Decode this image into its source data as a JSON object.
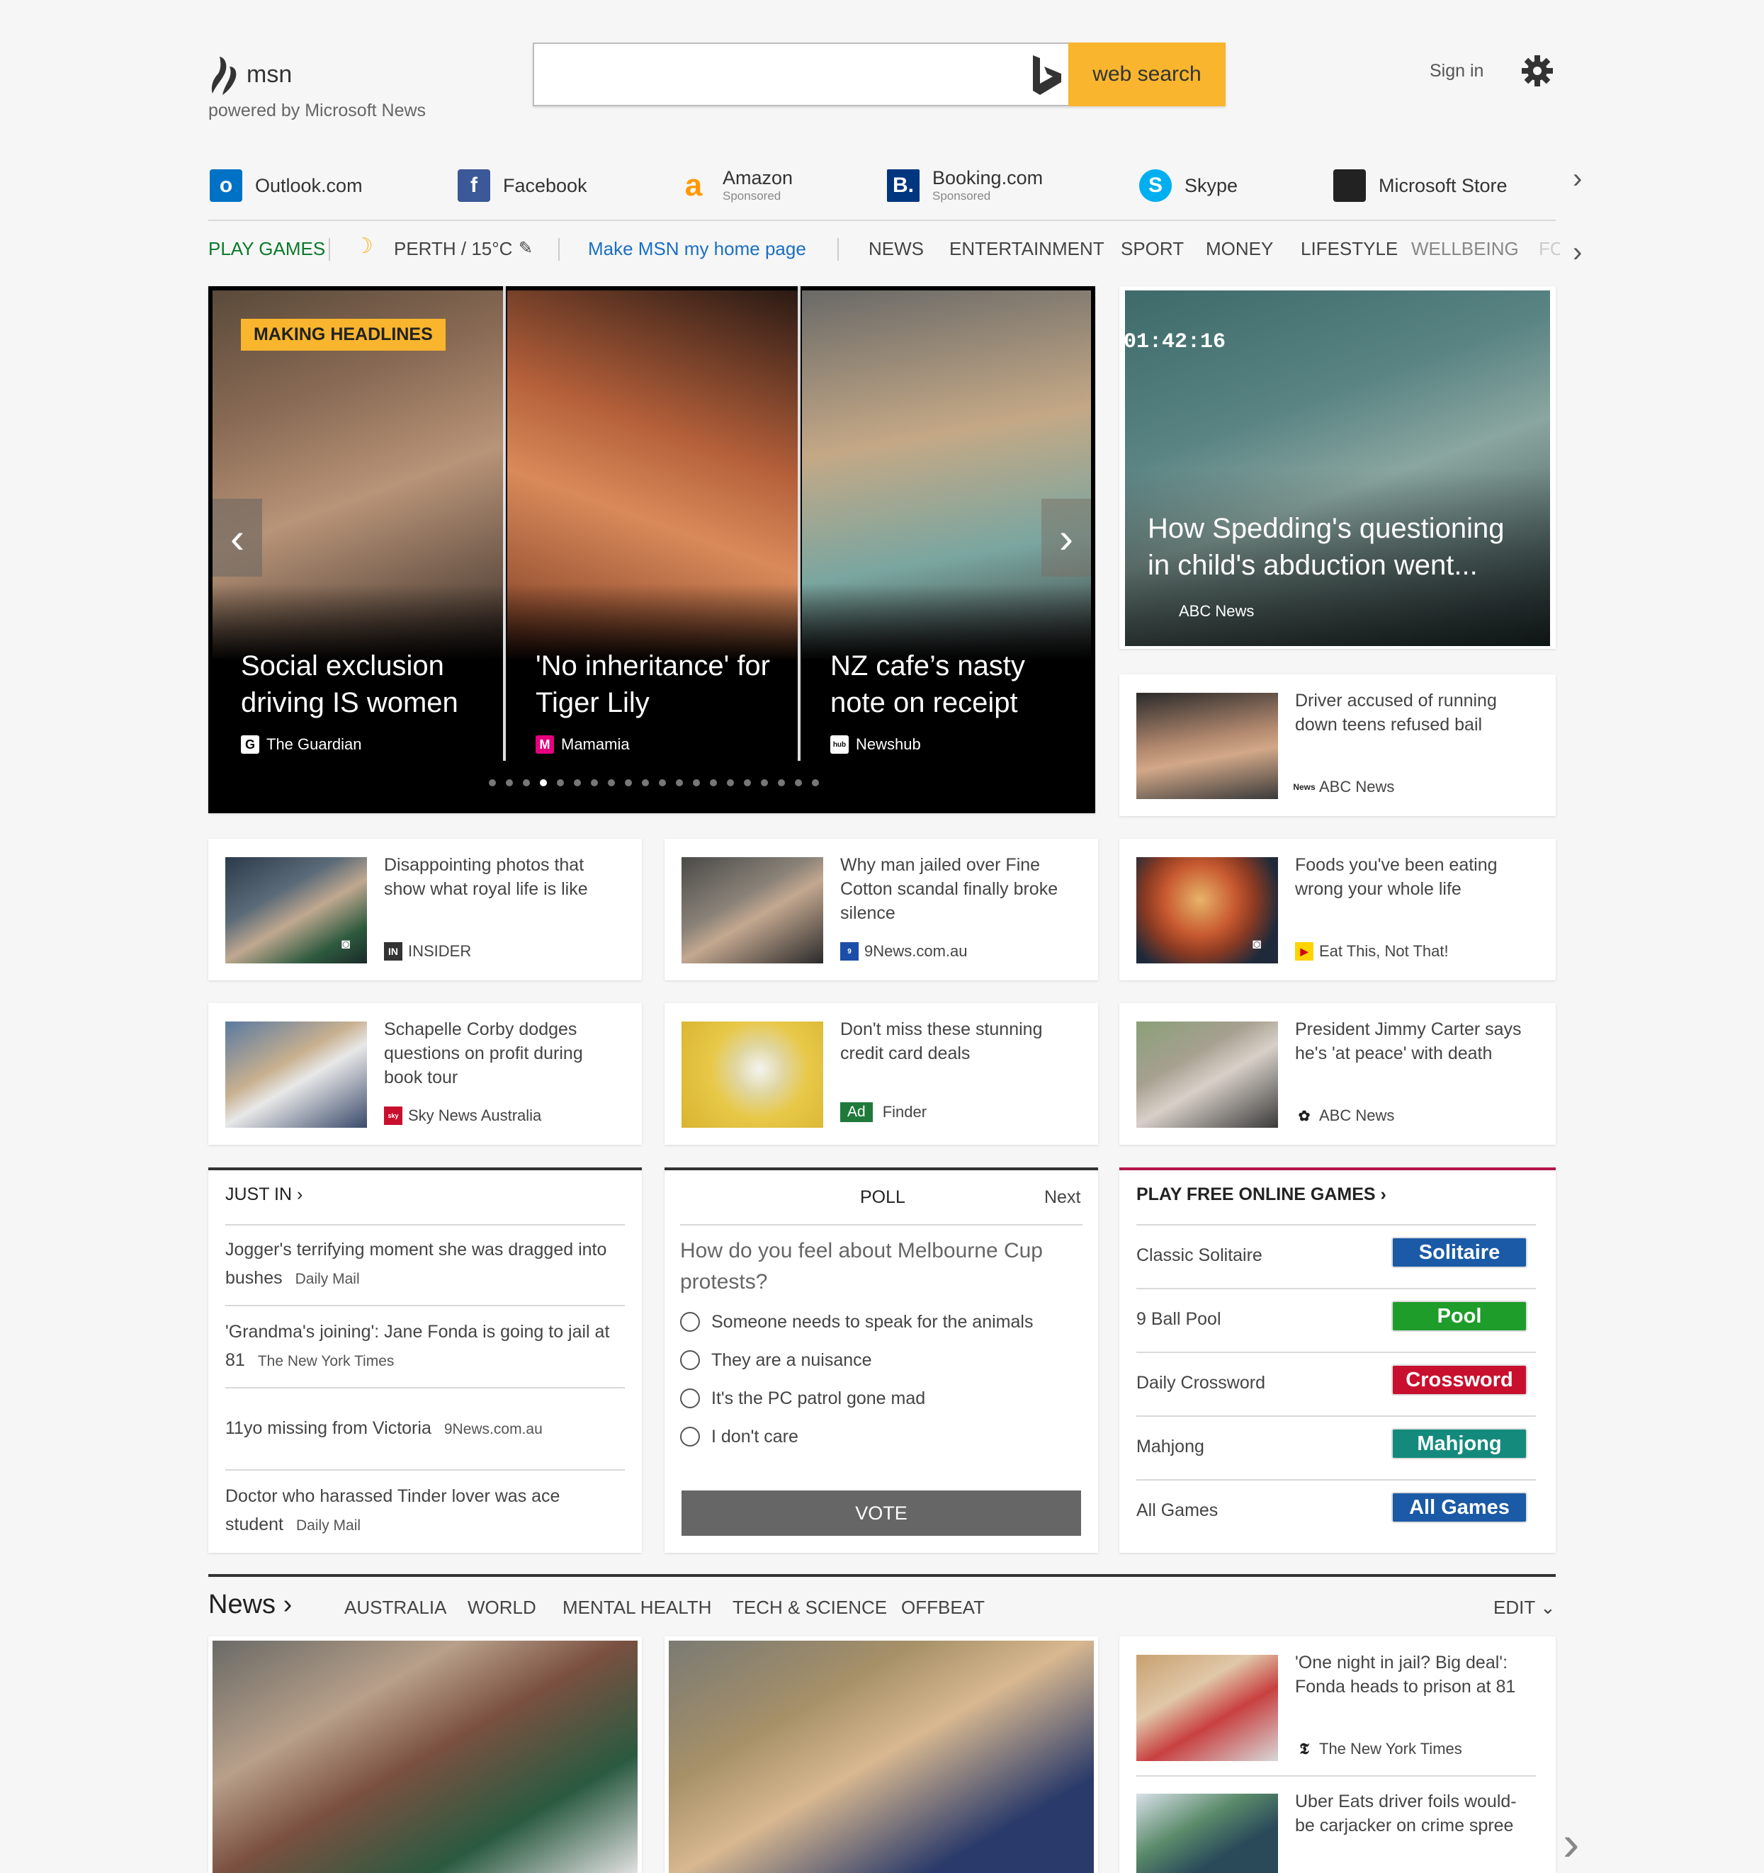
{
  "header": {
    "logo_text": "msn",
    "tagline": "powered by Microsoft News",
    "search_placeholder": "",
    "search_button": "web search",
    "sign_in": "Sign in"
  },
  "quicklinks": [
    {
      "label": "Outlook.com",
      "sub": "",
      "icon": "outlook-icon",
      "color": "#0072c6"
    },
    {
      "label": "Facebook",
      "sub": "",
      "icon": "facebook-icon",
      "color": "#3b5998"
    },
    {
      "label": "Amazon",
      "sub": "Sponsored",
      "icon": "amazon-icon",
      "color": "#ff9900"
    },
    {
      "label": "Booking.com",
      "sub": "Sponsored",
      "icon": "booking-icon",
      "color": "#003580"
    },
    {
      "label": "Skype",
      "sub": "",
      "icon": "skype-icon",
      "color": "#00aff0"
    },
    {
      "label": "Microsoft Store",
      "sub": "",
      "icon": "microsoft-store-icon",
      "color": "#333333"
    }
  ],
  "navbar": {
    "play_games": "PLAY GAMES",
    "weather": "PERTH / 15°C",
    "make_home": "Make MSN my home page",
    "items": [
      "NEWS",
      "ENTERTAINMENT",
      "SPORT",
      "MONEY",
      "LIFESTYLE",
      "WELLBEING",
      "FO"
    ]
  },
  "carousel": {
    "badge": "MAKING HEADLINES",
    "slides": [
      {
        "title": "Social exclusion driving IS women",
        "source": "The Guardian"
      },
      {
        "title": "'No inheritance' for Tiger Lily",
        "source": "Mamamia"
      },
      {
        "title": "NZ cafe’s nasty note on receipt",
        "source": "Newshub"
      }
    ],
    "total_slides": 20,
    "active_slide": 4
  },
  "feature_right": {
    "title": "How Spedding's questioning in child's abduction went...",
    "source": "ABC News",
    "timestamp": "01:42:16"
  },
  "driver_card": {
    "title": "Driver accused of running down teens refused bail",
    "source": "ABC News"
  },
  "cards": [
    {
      "title": "Disappointing photos that show what royal life is like",
      "source": "INSIDER"
    },
    {
      "title": "Why man jailed over Fine Cotton scandal finally broke silence",
      "source": "9News.com.au"
    },
    {
      "title": "Foods you've been eating wrong your whole life",
      "source": "Eat This, Not That!"
    },
    {
      "title": "Schapelle Corby dodges questions on profit during book tour",
      "source": "Sky News Australia"
    },
    {
      "title": "Don't miss these stunning credit card deals",
      "source": "Finder",
      "ad": "Ad"
    },
    {
      "title": "President Jimmy Carter says he's 'at peace' with death",
      "source": "ABC News"
    }
  ],
  "just_in": {
    "heading": "JUST IN",
    "items": [
      {
        "title": "Jogger's terrifying moment she was dragged into bushes",
        "source": "Daily Mail"
      },
      {
        "title": "'Grandma's joining': Jane Fonda is going to jail at 81",
        "source": "The New York Times"
      },
      {
        "title": "11yo missing from Victoria",
        "source": "9News.com.au"
      },
      {
        "title": "Doctor who harassed Tinder lover was ace student",
        "source": "Daily Mail"
      }
    ]
  },
  "poll": {
    "heading": "POLL",
    "next": "Next",
    "question": "How do you feel about Melbourne Cup protests?",
    "options": [
      "Someone needs to speak for the animals",
      "They are a nuisance",
      "It's the PC patrol gone mad",
      "I don't care"
    ],
    "vote": "VOTE"
  },
  "games": {
    "heading": "PLAY FREE ONLINE GAMES",
    "items": [
      {
        "label": "Classic Solitaire",
        "button": "Solitaire",
        "color": "#1a5aa6"
      },
      {
        "label": "9 Ball Pool",
        "button": "Pool",
        "color": "#1f9d2a"
      },
      {
        "label": "Daily Crossword",
        "button": "Crossword",
        "color": "#c8102e"
      },
      {
        "label": "Mahjong",
        "button": "Mahjong",
        "color": "#148a7d"
      },
      {
        "label": "All Games",
        "button": "All Games",
        "color": "#1a5aa6"
      }
    ]
  },
  "news_section": {
    "heading": "News",
    "tabs": [
      "AUSTRALIA",
      "WORLD",
      "MENTAL HEALTH",
      "TECH & SCIENCE",
      "OFFBEAT"
    ],
    "edit": "EDIT",
    "side_items": [
      {
        "title": "'One night in jail? Big deal': Fonda heads to prison at 81",
        "source": "The New York Times"
      },
      {
        "title": "Uber Eats driver foils would-be carjacker on crime spree",
        "source": ""
      }
    ]
  },
  "colors": {
    "accent": "#f8b52d",
    "link": "#1a6fc4",
    "play_green": "#0b7a2b",
    "games_bar": "#b5174b"
  }
}
